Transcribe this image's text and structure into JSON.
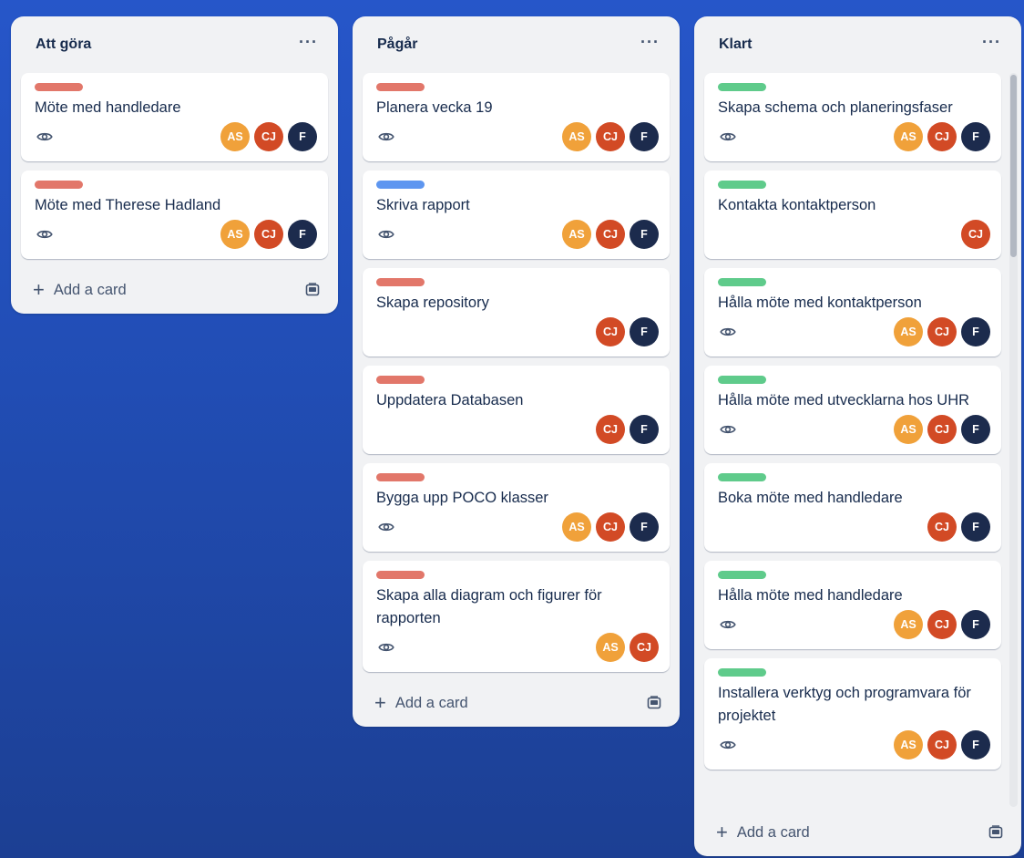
{
  "colors": {
    "label_red": "#e2776a",
    "label_blue": "#5e96f0",
    "label_green": "#5fcb8b",
    "avatar_AS": "#f0a13a",
    "avatar_CJ": "#d24a25",
    "avatar_F": "#1c2b4d"
  },
  "icons": {
    "watch": "eye-icon",
    "add": "plus-icon",
    "template": "card-template-icon",
    "menu": "ellipsis-icon"
  },
  "lists": [
    {
      "title": "Att göra",
      "menu": "···",
      "add_label": "Add a card",
      "cards": [
        {
          "label_color": "red",
          "title": "Möte med handledare",
          "watch": true,
          "members": [
            "AS",
            "CJ",
            "F"
          ]
        },
        {
          "label_color": "red",
          "title": "Möte med Therese Hadland",
          "watch": true,
          "members": [
            "AS",
            "CJ",
            "F"
          ]
        }
      ]
    },
    {
      "title": "Pågår",
      "menu": "···",
      "add_label": "Add a card",
      "cards": [
        {
          "label_color": "red",
          "title": "Planera vecka 19",
          "watch": true,
          "members": [
            "AS",
            "CJ",
            "F"
          ]
        },
        {
          "label_color": "blue",
          "title": "Skriva rapport",
          "watch": true,
          "members": [
            "AS",
            "CJ",
            "F"
          ]
        },
        {
          "label_color": "red",
          "title": "Skapa repository",
          "watch": false,
          "members": [
            "CJ",
            "F"
          ]
        },
        {
          "label_color": "red",
          "title": "Uppdatera Databasen",
          "watch": false,
          "members": [
            "CJ",
            "F"
          ]
        },
        {
          "label_color": "red",
          "title": "Bygga upp POCO klasser",
          "watch": true,
          "members": [
            "AS",
            "CJ",
            "F"
          ]
        },
        {
          "label_color": "red",
          "title": "Skapa alla diagram och figurer för rapporten",
          "watch": true,
          "members": [
            "AS",
            "CJ"
          ]
        }
      ]
    },
    {
      "title": "Klart",
      "menu": "···",
      "add_label": "Add a card",
      "cards": [
        {
          "label_color": "green",
          "title": "Skapa schema och planeringsfaser",
          "watch": true,
          "members": [
            "AS",
            "CJ",
            "F"
          ]
        },
        {
          "label_color": "green",
          "title": "Kontakta kontaktperson",
          "watch": false,
          "members": [
            "CJ"
          ]
        },
        {
          "label_color": "green",
          "title": "Hålla möte med kontaktperson",
          "watch": true,
          "members": [
            "AS",
            "CJ",
            "F"
          ]
        },
        {
          "label_color": "green",
          "title": "Hålla möte med utvecklarna hos UHR",
          "watch": true,
          "members": [
            "AS",
            "CJ",
            "F"
          ]
        },
        {
          "label_color": "green",
          "title": "Boka möte med handledare",
          "watch": false,
          "members": [
            "CJ",
            "F"
          ]
        },
        {
          "label_color": "green",
          "title": "Hålla möte med handledare",
          "watch": true,
          "members": [
            "AS",
            "CJ",
            "F"
          ]
        },
        {
          "label_color": "green",
          "title": "Installera verktyg och programvara för projektet",
          "watch": true,
          "members": [
            "AS",
            "CJ",
            "F"
          ]
        }
      ]
    }
  ]
}
